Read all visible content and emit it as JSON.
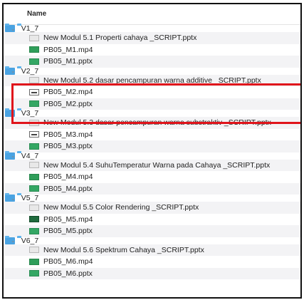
{
  "header": {
    "name_column": "Name"
  },
  "tree": [
    {
      "type": "folder",
      "label": "V1_7"
    },
    {
      "type": "file",
      "icon": "doc",
      "label": "New Modul 5.1 Properti cahaya _SCRIPT.pptx"
    },
    {
      "type": "file",
      "icon": "video",
      "label": "PB05_M1.mp4"
    },
    {
      "type": "file",
      "icon": "ppt",
      "label": "PB05_M1.pptx"
    },
    {
      "type": "folder",
      "label": "V2_7"
    },
    {
      "type": "file",
      "icon": "doc",
      "label": "New Modul 5.2 dasar pencampuran warna additive _SCRIPT.pptx"
    },
    {
      "type": "file",
      "icon": "video-alt",
      "label": "PB05_M2.mp4"
    },
    {
      "type": "file",
      "icon": "ppt",
      "label": "PB05_M2.pptx"
    },
    {
      "type": "folder",
      "label": "V3_7"
    },
    {
      "type": "file",
      "icon": "doc",
      "label": "New Modul 5.3 dasar pencampuran warna substraktiv _SCRIPT.pptx"
    },
    {
      "type": "file",
      "icon": "video-alt",
      "label": "PB05_M3.mp4"
    },
    {
      "type": "file",
      "icon": "ppt",
      "label": "PB05_M3.pptx"
    },
    {
      "type": "folder",
      "label": "V4_7"
    },
    {
      "type": "file",
      "icon": "doc",
      "label": "New Modul 5.4 SuhuTemperatur Warna pada Cahaya _SCRIPT.pptx"
    },
    {
      "type": "file",
      "icon": "video",
      "label": "PB05_M4.mp4"
    },
    {
      "type": "file",
      "icon": "ppt",
      "label": "PB05_M4.pptx"
    },
    {
      "type": "folder",
      "label": "V5_7"
    },
    {
      "type": "file",
      "icon": "doc",
      "label": "New Modul 5.5 Color Rendering _SCRIPT.pptx"
    },
    {
      "type": "file",
      "icon": "video-dark",
      "label": "PB05_M5.mp4"
    },
    {
      "type": "file",
      "icon": "ppt",
      "label": "PB05_M5.pptx"
    },
    {
      "type": "folder",
      "label": "V6_7"
    },
    {
      "type": "file",
      "icon": "doc",
      "label": "New Modul 5.6 Spektrum Cahaya _SCRIPT.pptx"
    },
    {
      "type": "file",
      "icon": "video",
      "label": "PB05_M6.mp4"
    },
    {
      "type": "file",
      "icon": "ppt",
      "label": "PB05_M6.pptx"
    }
  ],
  "colors": {
    "highlight": "#e0141b",
    "folder": "#4aa3e2",
    "row_alt": "#f3f3f5"
  }
}
